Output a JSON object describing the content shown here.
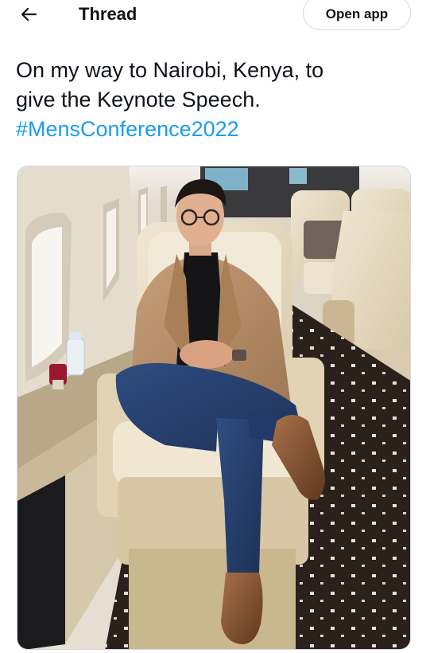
{
  "header": {
    "back_icon": "arrow-left-icon",
    "title": "Thread",
    "open_app_label": "Open app"
  },
  "tweet": {
    "line1": "On my way to Nairobi, Kenya, to",
    "line2": "give the Keynote Speech.",
    "hashtag": "#MensConference2022"
  },
  "colors": {
    "text": "#0f1419",
    "link": "#1d9bf0",
    "border": "#cfd9de"
  }
}
